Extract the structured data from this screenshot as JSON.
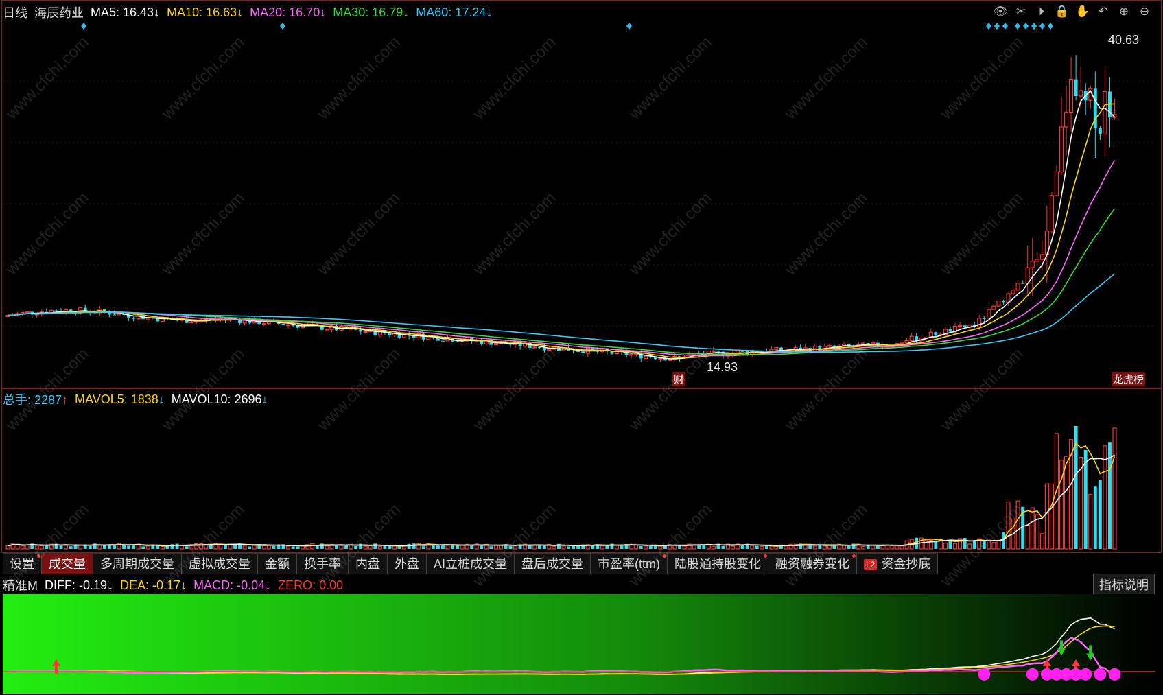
{
  "header": {
    "period": "日线",
    "stock_name": "海辰药业",
    "ma": [
      {
        "label": "MA5: 16.43",
        "arrow": "↓",
        "color": "#ffffff"
      },
      {
        "label": "MA10: 16.63",
        "arrow": "↓",
        "color": "#ffd800"
      },
      {
        "label": "MA20: 16.70",
        "arrow": "↓",
        "color": "#ff66ff"
      },
      {
        "label": "MA30: 16.79",
        "arrow": "↓",
        "color": "#33dd33"
      },
      {
        "label": "MA60: 17.24",
        "arrow": "↓",
        "color": "#33ccff"
      }
    ]
  },
  "toolbar_icons": [
    "eye-icon",
    "scissors-icon",
    "play-icon",
    "lock-icon",
    "hand-icon",
    "undo-icon",
    "zoom-in-icon",
    "zoom-out-icon"
  ],
  "price_annotations": {
    "high": "40.63",
    "low": "14.93",
    "fin_tag": "财",
    "lhb_tag": "龙虎榜"
  },
  "volume_legend": [
    {
      "label": "总手: 2287",
      "arrow": "↑",
      "color": "#33ccff",
      "arrow_color": "#ff4444"
    },
    {
      "label": "MAVOL5: 1838",
      "arrow": "↓",
      "color": "#ffd800",
      "arrow_color": "#33ccff"
    },
    {
      "label": "MAVOL10: 2696",
      "arrow": "↓",
      "color": "#ffffff",
      "arrow_color": "#33ccff"
    }
  ],
  "tabs": [
    {
      "label": "设置",
      "active": false,
      "dot": true
    },
    {
      "label": "成交量",
      "active": true,
      "dot": false
    },
    {
      "label": "多周期成交量",
      "active": false,
      "dot": false
    },
    {
      "label": "虚拟成交量",
      "active": false,
      "dot": false
    },
    {
      "label": "金额",
      "active": false,
      "dot": false
    },
    {
      "label": "换手率",
      "active": false,
      "dot": false
    },
    {
      "label": "内盘",
      "active": false,
      "dot": false
    },
    {
      "label": "外盘",
      "active": false,
      "dot": false
    },
    {
      "label": "AI立桩成交量",
      "active": false,
      "dot": false
    },
    {
      "label": "盘后成交量",
      "active": false,
      "dot": false
    },
    {
      "label": "市盈率(ttm)",
      "active": false,
      "dot": true
    },
    {
      "label": "陆股通持股变化",
      "active": false,
      "dot": true
    },
    {
      "label": "融资融券变化",
      "active": false,
      "dot": true
    },
    {
      "label": "资金抄底",
      "active": false,
      "dot": false,
      "badge": "L2"
    }
  ],
  "macd_legend": [
    {
      "label": "精准M",
      "color": "#dddddd"
    },
    {
      "label": "DIFF: -0.19",
      "arrow": "↓",
      "color": "#ffffff"
    },
    {
      "label": "DEA: -0.17",
      "arrow": "↓",
      "color": "#ffd800"
    },
    {
      "label": "MACD: -0.04",
      "arrow": "↓",
      "color": "#ff66ff"
    },
    {
      "label": "ZERO: 0.00",
      "arrow": "",
      "color": "#ff3333"
    }
  ],
  "explain_button": "指标说明",
  "watermark_text": "www.cfchi.com",
  "colors": {
    "up": "#ff3333",
    "down": "#33ddee",
    "ma5": "#ffffff",
    "ma10": "#ffd800",
    "ma20": "#ff66ff",
    "ma30": "#33dd33",
    "ma60": "#33ccff",
    "border": "#8a1b1b"
  },
  "chart_data": {
    "type": "candlestick",
    "price_range": [
      14.93,
      40.63
    ],
    "candles": {
      "open": [],
      "high": [],
      "low": [],
      "close": []
    },
    "macd_markers": {
      "down_arrows": 2,
      "up_arrows": 3,
      "magenta_dots": 9
    }
  }
}
